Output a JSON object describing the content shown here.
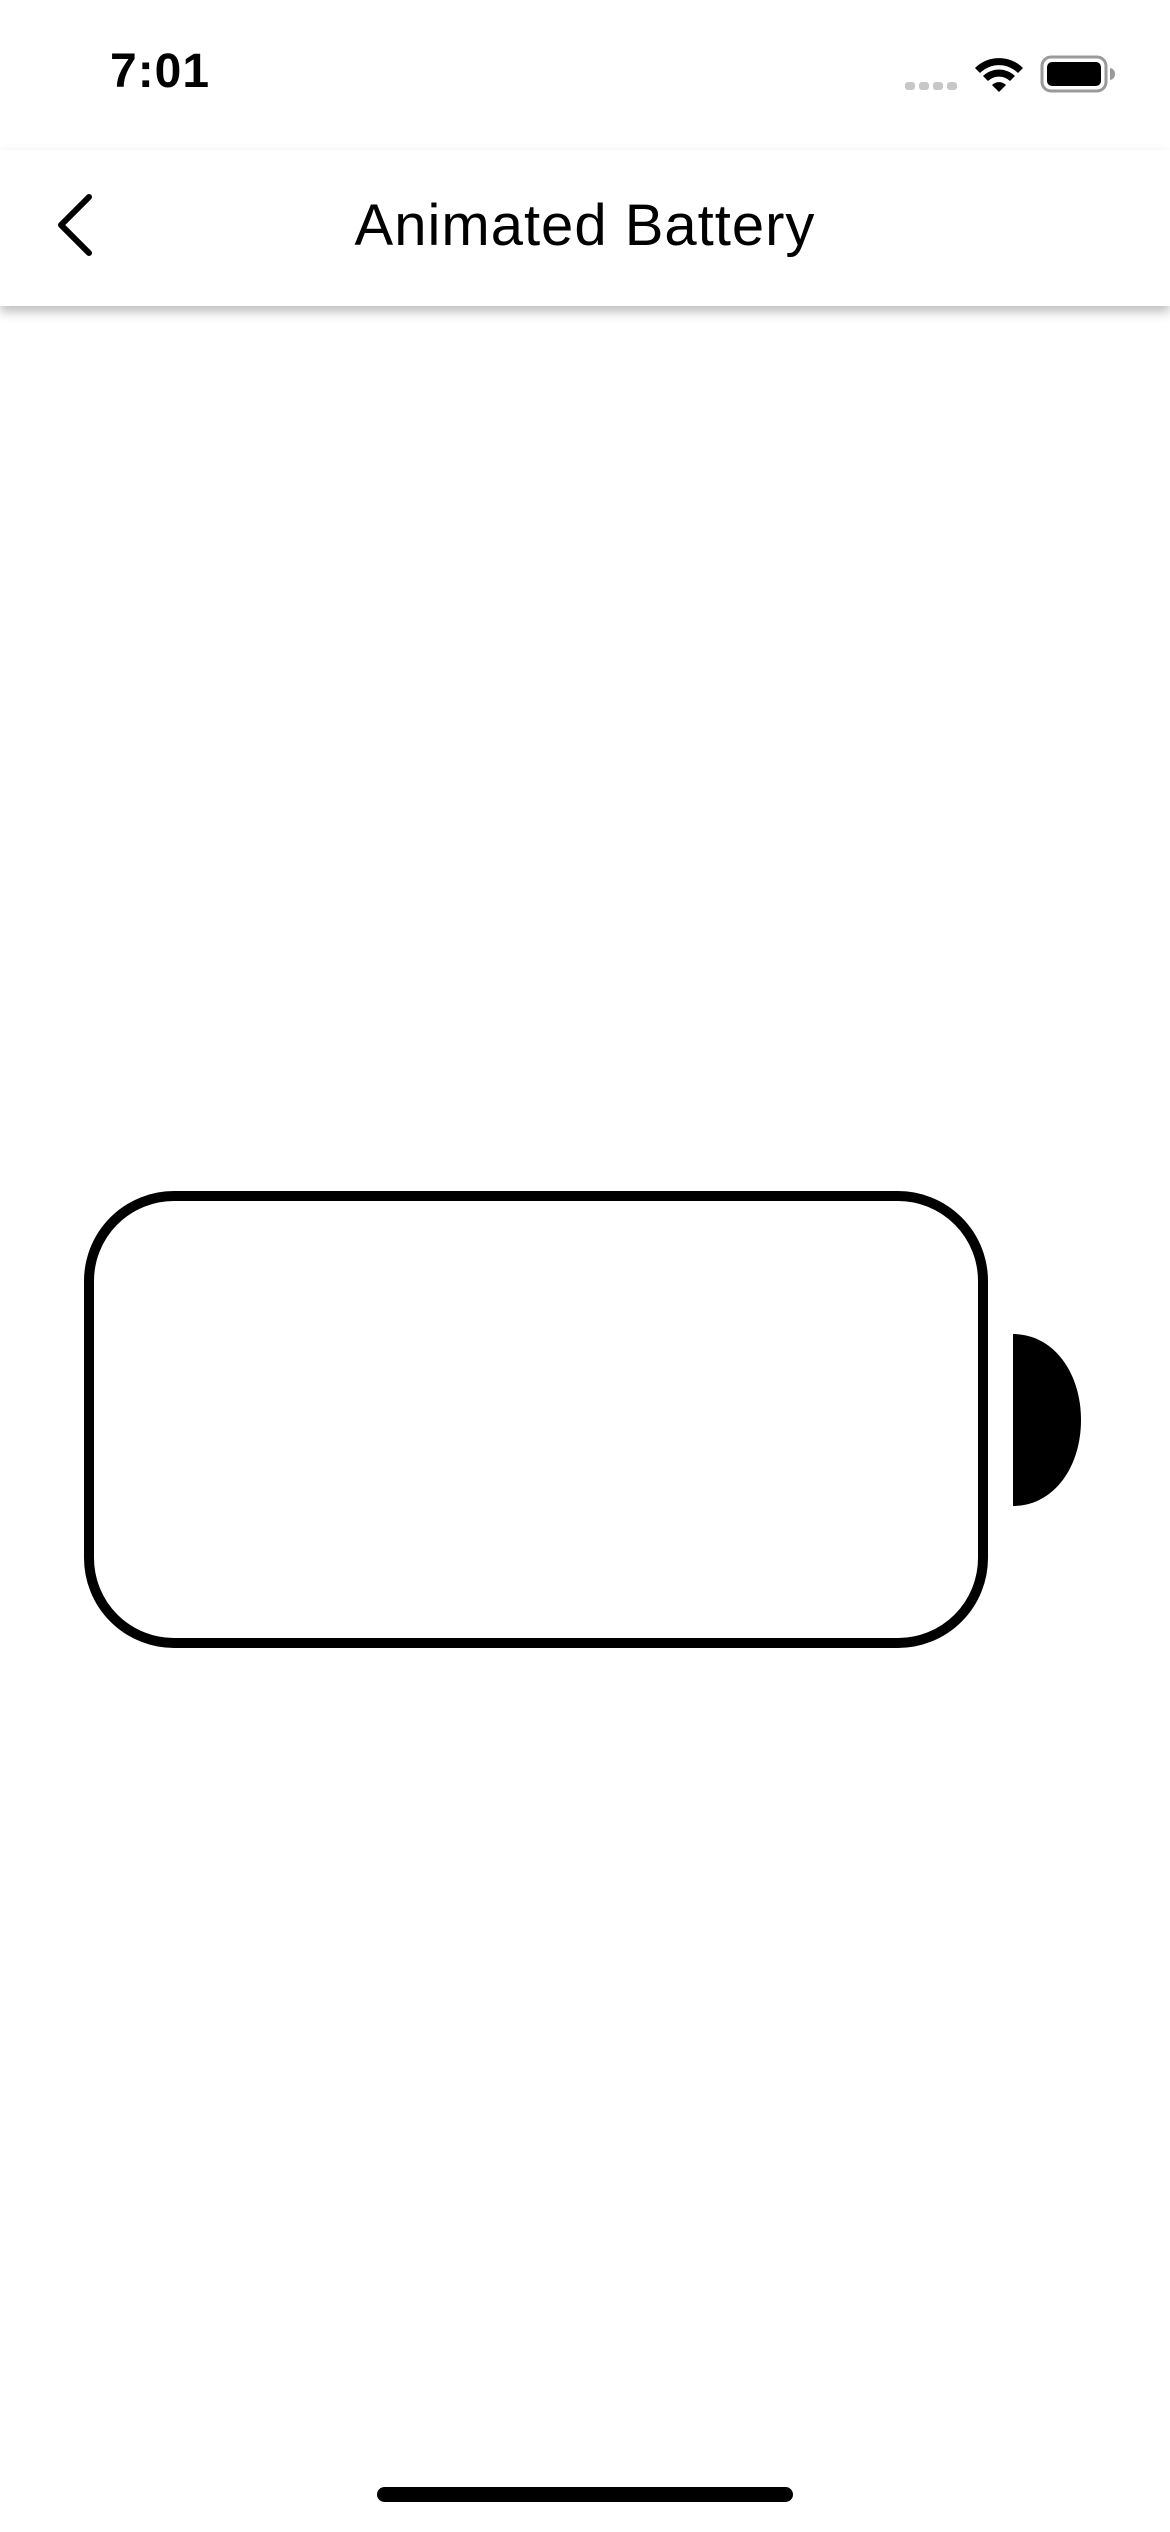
{
  "status_bar": {
    "time": "7:01",
    "icons": [
      "cellular-signal-icon",
      "wifi-icon",
      "battery-icon"
    ]
  },
  "nav": {
    "back_icon": "chevron-left-icon",
    "title": "Animated Battery"
  },
  "battery": {
    "level": 0,
    "outline_color": "#000000",
    "fill_color": "#2ecc40"
  },
  "colors": {
    "background": "#ffffff",
    "foreground": "#000000"
  }
}
